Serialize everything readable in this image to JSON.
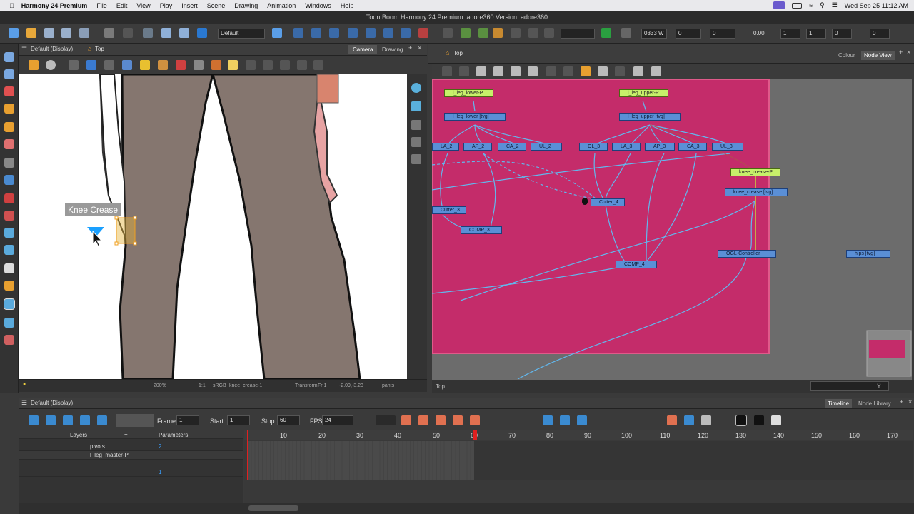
{
  "menubar": {
    "app": "Harmony 24 Premium",
    "items": [
      "File",
      "Edit",
      "View",
      "Play",
      "Insert",
      "Scene",
      "Drawing",
      "Animation",
      "Windows",
      "Help"
    ],
    "datetime": "Wed Sep 25  11:12 AM"
  },
  "window": {
    "title": "Toon Boom Harmony 24 Premium: adore360 Version: adore360"
  },
  "toolbar": {
    "workspace": "Default",
    "zoom_field": "0333 W",
    "x_field": "0",
    "y_field": "0",
    "z_field": "0.00",
    "f1": "1",
    "f2": "1",
    "f3": "0",
    "f4": "0"
  },
  "camera_panel": {
    "view_name": "Default (Display)",
    "top_label": "Top",
    "tab_camera": "Camera",
    "tab_drawing": "Drawing",
    "tooltip": "Knee Crease",
    "status_zoom": "200%",
    "status_ratio": "1:1",
    "status_color": "sRGB",
    "status_node": "knee_crease-1",
    "status_tool": "Transform",
    "status_frame": "Fr 1",
    "status_coords": "-2.09,-3.23",
    "status_layer": "pants"
  },
  "node_panel": {
    "top_label": "Top",
    "tab_colour": "Colour",
    "tab_nodeview": "Node View",
    "status_left": "Top",
    "nodes": {
      "l_leg_lower_p": "l_leg_lower-P",
      "l_leg_upper_p": "l_leg_upper-P",
      "l_leg_lower_tvg": "l_leg_lower [tvg]",
      "l_leg_upper_tvg": "l_leg_upper [tvg]",
      "la2": "LA_2",
      "ap2": "AP_2",
      "ca2": "CA_2",
      "ul2": "UL_2",
      "ol3": "OL_3",
      "la3": "LA_3",
      "ap3": "AP_3",
      "ca3": "CA_3",
      "ul3": "UL_3",
      "knee_crease_p": "knee_crease-P",
      "knee_crease_tvg": "knee_crease [tvg]",
      "cutter3": "Cutter_3",
      "cutter4": "Cutter_4",
      "comp3": "COMP_3",
      "comp4": "COMP_4",
      "ogl": "OGL-Controller",
      "hips": "hips [tvg]"
    }
  },
  "timeline": {
    "view_name": "Default (Display)",
    "tab_timeline": "Timeline",
    "tab_nodelib": "Node Library",
    "frame_label": "Frame",
    "frame_value": "1",
    "start_label": "Start",
    "start_value": "1",
    "stop_label": "Stop",
    "stop_value": "60",
    "fps_label": "FPS",
    "fps_value": "24",
    "layers_header": "Layers",
    "params_header": "Parameters",
    "ticks": [
      "10",
      "20",
      "30",
      "40",
      "50",
      "60",
      "70",
      "80",
      "90",
      "100",
      "110",
      "120",
      "130",
      "140",
      "150",
      "160",
      "170"
    ],
    "layers": [
      {
        "name": "pivots",
        "param": "2"
      },
      {
        "name": "l_leg_master-P",
        "param": ""
      },
      {
        "name": "",
        "param": ""
      },
      {
        "name": "",
        "param": "1"
      }
    ]
  },
  "colors": {
    "node_bg": "#c42c6a",
    "accent_orange": "#f0a020",
    "node_blue": "#5a8fd6",
    "peg_green": "#c7f06a",
    "cursor_blue": "#1aa0ff"
  }
}
